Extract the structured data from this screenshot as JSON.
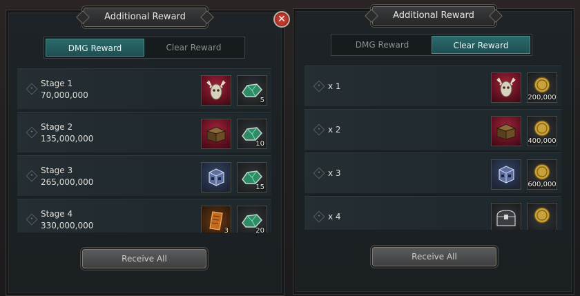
{
  "panels": [
    {
      "title": "Additional Reward",
      "tabs": [
        {
          "label": "DMG Reward",
          "active": true
        },
        {
          "label": "Clear Reward",
          "active": false
        }
      ],
      "rows": [
        {
          "label": "Stage 1",
          "amount": "70,000,000",
          "reward_icon": "deer-skull-icon",
          "reward_bg": "red",
          "second_icon": "green-gem-icon",
          "second_qty": "5"
        },
        {
          "label": "Stage 2",
          "amount": "135,000,000",
          "reward_icon": "treasure-chest-icon",
          "reward_bg": "red",
          "second_icon": "green-gem-icon",
          "second_qty": "10"
        },
        {
          "label": "Stage 3",
          "amount": "265,000,000",
          "reward_icon": "rune-dice-icon",
          "reward_bg": "blue",
          "second_icon": "green-gem-icon",
          "second_qty": "15"
        },
        {
          "label": "Stage 4",
          "amount": "330,000,000",
          "reward_icon": "scroll-icon",
          "reward_bg": "orange",
          "reward_qty": "3",
          "second_icon": "green-gem-icon",
          "second_qty": "20"
        }
      ],
      "button": "Receive All"
    },
    {
      "title": "Additional Reward",
      "tabs": [
        {
          "label": "DMG Reward",
          "active": false
        },
        {
          "label": "Clear Reward",
          "active": true
        }
      ],
      "rows": [
        {
          "label": "x 1",
          "reward_icon": "deer-skull-icon",
          "reward_bg": "red",
          "second_icon": "gold-coin-icon",
          "second_qty": "200,000"
        },
        {
          "label": "x 2",
          "reward_icon": "treasure-chest-icon",
          "reward_bg": "red",
          "second_icon": "gold-coin-icon",
          "second_qty": "400,000"
        },
        {
          "label": "x 3",
          "reward_icon": "rune-dice-icon",
          "reward_bg": "blue",
          "second_icon": "gold-coin-icon",
          "second_qty": "600,000"
        },
        {
          "label": "x 4",
          "reward_icon": "iron-chest-icon",
          "reward_bg": "dark",
          "second_icon": "gold-coin-icon",
          "second_qty": ""
        }
      ],
      "button": "Receive All"
    }
  ],
  "close_icon": "close-icon",
  "colors": {
    "active_tab": "#2b6a6b",
    "panel": "#1d2326",
    "red_slot": "#a0223a",
    "blue_slot": "#364666"
  }
}
